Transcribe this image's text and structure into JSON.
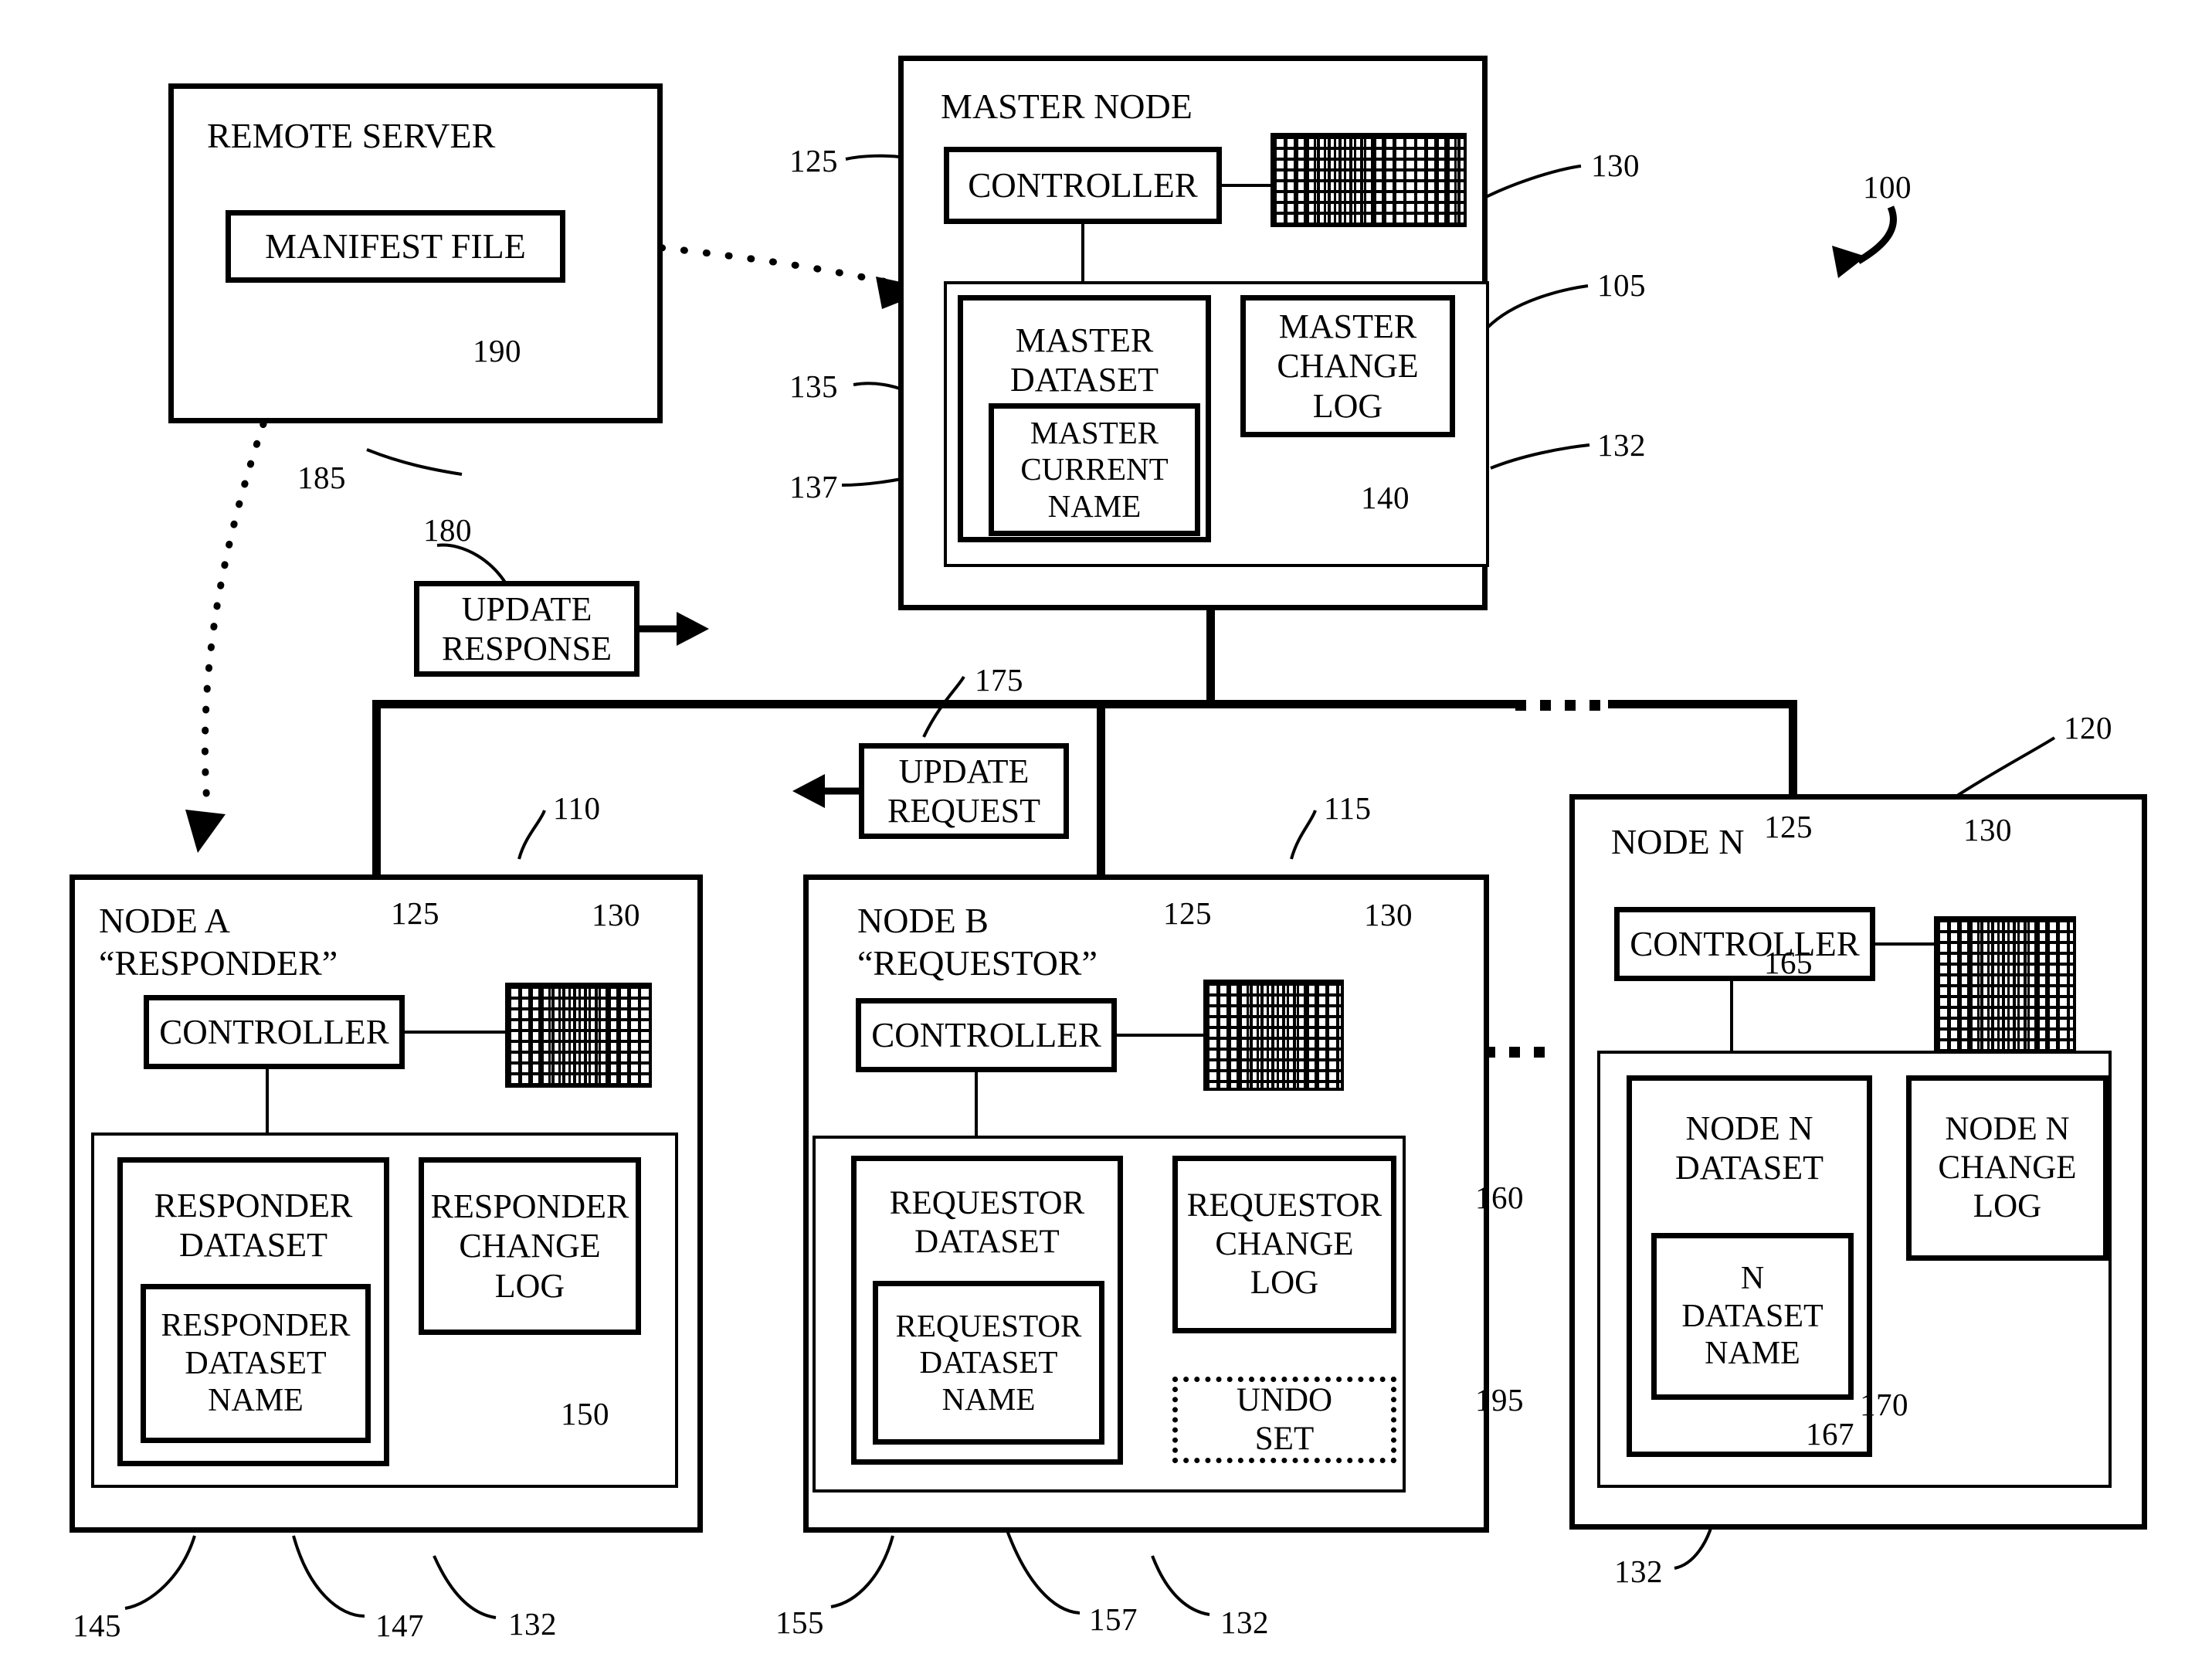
{
  "figure": {
    "system_ref": "100",
    "boxes": {
      "remote_server": {
        "title": "REMOTE SERVER",
        "ref": "185"
      },
      "manifest_file": {
        "label": "MANIFEST FILE",
        "ref": "190"
      },
      "master_node": {
        "title": "MASTER NODE",
        "ref": "105"
      },
      "master_controller": {
        "label": "CONTROLLER",
        "ref": "125"
      },
      "master_memory": {
        "ref": "130"
      },
      "master_storage": {
        "ref": "132"
      },
      "master_dataset": {
        "label": "MASTER\nDATASET",
        "ref": "135"
      },
      "master_current_name": {
        "label": "MASTER\nCURRENT\nNAME",
        "ref": "137"
      },
      "master_change_log": {
        "label": "MASTER\nCHANGE\nLOG",
        "ref": "140"
      },
      "update_response": {
        "label": "UPDATE\nRESPONSE",
        "ref": "180"
      },
      "update_request": {
        "label": "UPDATE\nREQUEST",
        "ref": "175"
      },
      "node_a": {
        "title": "NODE A\n“RESPONDER”",
        "ref": "110"
      },
      "node_a_controller": {
        "label": "CONTROLLER",
        "ref": "125"
      },
      "node_a_memory": {
        "ref": "130"
      },
      "node_a_storage": {
        "ref": "132"
      },
      "responder_dataset": {
        "label": "RESPONDER\nDATASET",
        "ref": "145"
      },
      "responder_dataset_name": {
        "label": "RESPONDER\nDATASET\nNAME",
        "ref": "147"
      },
      "responder_change_log": {
        "label": "RESPONDER\nCHANGE\nLOG",
        "ref": "150"
      },
      "node_b": {
        "title": "NODE B\n“REQUESTOR”",
        "ref": "115"
      },
      "node_b_controller": {
        "label": "CONTROLLER",
        "ref": "125"
      },
      "node_b_memory": {
        "ref": "130"
      },
      "node_b_storage": {
        "ref": "132"
      },
      "requestor_dataset": {
        "label": "REQUESTOR\nDATASET",
        "ref": "155"
      },
      "requestor_dataset_name": {
        "label": "REQUESTOR\nDATASET\nNAME",
        "ref": "157"
      },
      "requestor_change_log": {
        "label": "REQUESTOR\nCHANGE\nLOG",
        "ref": "160"
      },
      "undo_set": {
        "label": "UNDO\nSET",
        "ref": "195"
      },
      "node_n": {
        "title": "NODE N",
        "ref": "120"
      },
      "node_n_controller": {
        "label": "CONTROLLER",
        "ref": "125"
      },
      "node_n_memory": {
        "ref": "130"
      },
      "node_n_storage": {
        "ref": "132"
      },
      "node_n_dataset": {
        "label": "NODE N\nDATASET",
        "ref": "165"
      },
      "node_n_dataset_name": {
        "label": "N\nDATASET\nNAME",
        "ref": "167"
      },
      "node_n_change_log": {
        "label": "NODE N\nCHANGE\nLOG",
        "ref": "170"
      }
    },
    "colors": {
      "ink": "#000000",
      "paper": "#ffffff"
    }
  }
}
